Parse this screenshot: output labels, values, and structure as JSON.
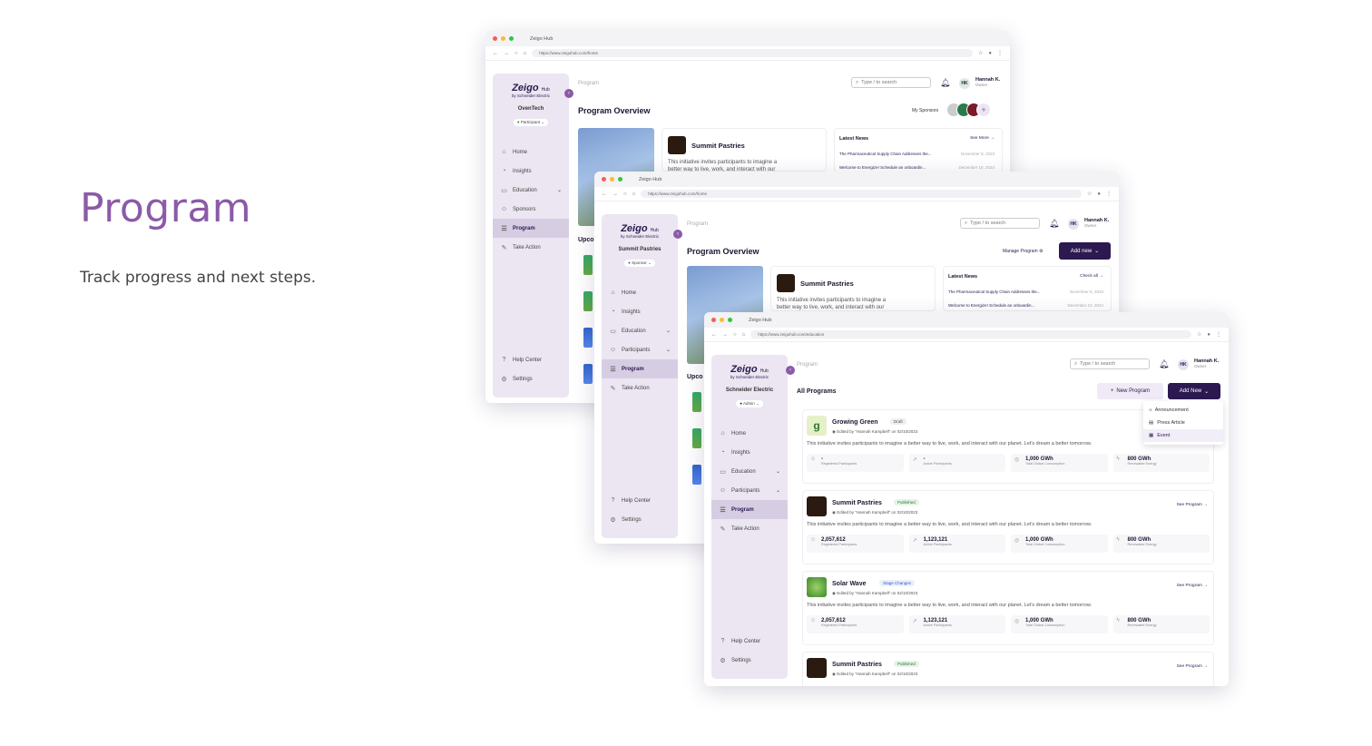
{
  "hero": {
    "title": "Program",
    "subtitle": "Track progress and next steps."
  },
  "browser": {
    "tab": "Zeigo Hub"
  },
  "brand": {
    "logo": "Zeigo",
    "logo_suffix": "Hub",
    "by": "by Schneider Electric"
  },
  "user": {
    "initials": "HK",
    "name": "Hannah K.",
    "role": "Owner"
  },
  "search": {
    "placeholder": "Type / to search"
  },
  "nav": {
    "home": "Home",
    "insights": "Insights",
    "education": "Education",
    "sponsors": "Sponsors",
    "participants": "Participants",
    "program": "Program",
    "take_action": "Take Action",
    "help": "Help Center",
    "settings": "Settings"
  },
  "win1": {
    "url": "https://www.zeigohub.com/home",
    "org": "OvenTech",
    "role": "Participant",
    "breadcrumb": "Program",
    "title": "Program Overview",
    "my_sponsors": "My Sponsors",
    "program_name": "Summit Pastries",
    "program_desc_1": "This initiative invites participants to imagine a",
    "program_desc_2": "better way to live, work, and interact with our",
    "news_title": "Latest News",
    "news_more": "See More",
    "news": [
      {
        "title": "The Pharmaceutical Supply Chain Addresses the...",
        "date": "November 8, 2023"
      },
      {
        "title": "Welcome to Energize! Schedule an onboardin...",
        "date": "December 10, 2024"
      }
    ],
    "upcoming": "Upco"
  },
  "win2": {
    "url": "https://www.zeigohub.com/home",
    "org": "Summit Pastries",
    "role": "Sponsor",
    "breadcrumb": "Program",
    "title": "Program Overview",
    "manage": "Manage Program",
    "add_new": "Add new",
    "program_name": "Summit Pastries",
    "program_desc_1": "This initiative invites participants to imagine a",
    "program_desc_2": "better way to live, work, and interact with our",
    "news_title": "Latest News",
    "news_more": "Check all",
    "news": [
      {
        "title": "The Pharmaceutical Supply Chain Addresses the...",
        "date": "November 8, 2023"
      },
      {
        "title": "Welcome to Energize! Schedule an onboardin...",
        "date": "December 10, 2024"
      }
    ],
    "upcoming": "Upco"
  },
  "win3": {
    "url": "https://www.zeigohub.com/education",
    "org": "Schneider Electric",
    "role": "Admin",
    "breadcrumb": "Program",
    "title": "All Programs",
    "new_program": "New Program",
    "add_new": "Add New",
    "dropdown": [
      "Announcement",
      "Press Article",
      "Event"
    ],
    "annc": "Ann",
    "programs": [
      {
        "name": "Growing Green",
        "status": "Draft",
        "edited": "Edited by \"Hannah Kampbell\" on 02/10/2023",
        "desc": "This initiative invites participants to imagine a better way to live, work, and interact with our planet. Let's dream a better tomorrow.",
        "see": "",
        "stats": [
          {
            "v": "-",
            "l": "Registered Participants"
          },
          {
            "v": "-",
            "l": "Active Participants"
          },
          {
            "v": "1,000 GWh",
            "l": "Total Global Consumption"
          },
          {
            "v": "800 GWh",
            "l": "Renewable Energy"
          }
        ]
      },
      {
        "name": "Summit Pastries",
        "status": "Published",
        "edited": "Edited by \"Hannah Kampbell\" on 02/10/2023",
        "desc": "This initiative invites participants to imagine a better way to live, work, and interact with our planet. Let's dream a better tomorrow.",
        "see": "See Program",
        "stats": [
          {
            "v": "2,057,612",
            "l": "Registered Participants"
          },
          {
            "v": "1,123,121",
            "l": "Active Participants"
          },
          {
            "v": "1,000 GWh",
            "l": "Total Global Consumption"
          },
          {
            "v": "800 GWh",
            "l": "Renewable Energy"
          }
        ]
      },
      {
        "name": "Solar Wave",
        "status": "Stage Changes",
        "edited": "Edited by \"Hannah Kampbell\" on 02/10/2023",
        "desc": "This initiative invites participants to imagine a better way to live, work, and interact with our planet. Let's dream a better tomorrow.",
        "see": "See Program",
        "stats": [
          {
            "v": "2,057,612",
            "l": "Registered Participants"
          },
          {
            "v": "1,123,121",
            "l": "Active Participants"
          },
          {
            "v": "1,000 GWh",
            "l": "Total Global Consumption"
          },
          {
            "v": "800 GWh",
            "l": "Renewable Energy"
          }
        ]
      },
      {
        "name": "Summit Pastries",
        "status": "Published",
        "edited": "Edited by \"Hannah Kampbell\" on 02/10/2023",
        "desc": "",
        "see": "See Program",
        "stats": []
      }
    ]
  },
  "colors": {
    "brand": "#2b1950",
    "accent": "#8b5aa8",
    "sidebar": "#ebe6f1"
  }
}
